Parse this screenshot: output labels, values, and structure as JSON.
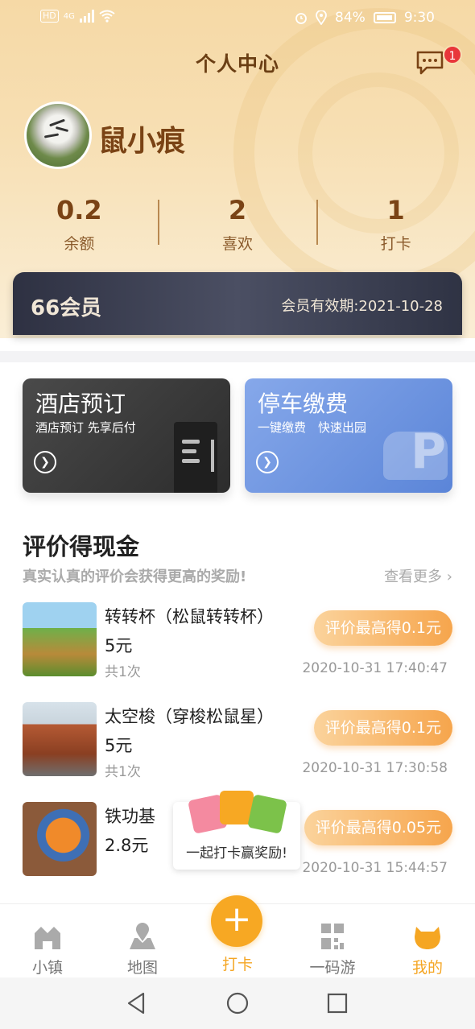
{
  "status_bar": {
    "network": "4G",
    "hd": "HD",
    "battery": "84%",
    "time": "9:30"
  },
  "header": {
    "title": "个人中心",
    "notification_count": "1"
  },
  "profile": {
    "username": "鼠小痕"
  },
  "stats": [
    {
      "value": "0.2",
      "label": "余额"
    },
    {
      "value": "2",
      "label": "喜欢"
    },
    {
      "value": "1",
      "label": "打卡"
    }
  ],
  "membership": {
    "name": "66会员",
    "expiry": "会员有效期:2021-10-28"
  },
  "services": {
    "hotel": {
      "title": "酒店预订",
      "subtitle": "酒店预订 先享后付"
    },
    "parking": {
      "title": "停车缴费",
      "subtitle": "一键缴费　快速出园"
    }
  },
  "reviews": {
    "title": "评价得现金",
    "subtitle": "真实认真的评价会获得更高的奖励!",
    "more": "查看更多",
    "items": [
      {
        "name": "转转杯（松鼠转转杯）",
        "price": "5元",
        "count": "共1次",
        "reward": "评价最高得0.1元",
        "time": "2020-10-31 17:40:47"
      },
      {
        "name": "太空梭（穿梭松鼠星）",
        "price": "5元",
        "count": "共1次",
        "reward": "评价最高得0.1元",
        "time": "2020-10-31 17:30:58"
      },
      {
        "name": "铁功基",
        "price": "2.8元",
        "count": "",
        "reward": "评价最高得0.05元",
        "time": "2020-10-31 15:44:57"
      }
    ]
  },
  "popup": {
    "text": "一起打卡赢奖励!"
  },
  "tabs": [
    {
      "label": "小镇",
      "icon": "town-icon"
    },
    {
      "label": "地图",
      "icon": "map-pin-icon"
    },
    {
      "label": "打卡",
      "icon": "plus-icon"
    },
    {
      "label": "一码游",
      "icon": "qr-code-icon"
    },
    {
      "label": "我的",
      "icon": "squirrel-head-icon"
    }
  ],
  "colors": {
    "accent": "#f5a623",
    "brown": "#7a4315",
    "member_bg": "#2e3142"
  }
}
